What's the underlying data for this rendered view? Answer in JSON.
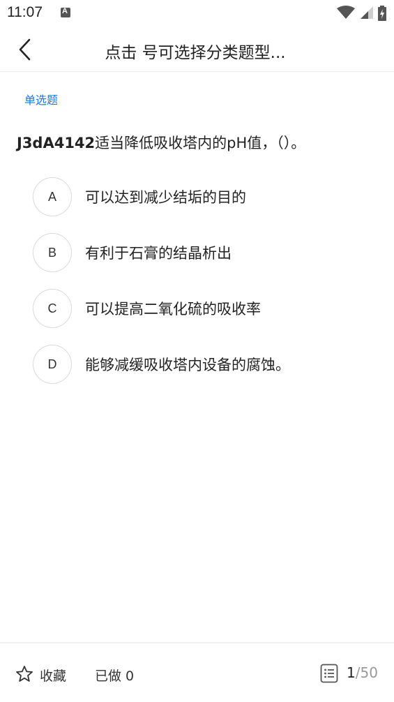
{
  "status_bar": {
    "time": "11:07",
    "icons": [
      "a-notification-icon",
      "wifi-icon",
      "cellular-signal-icon",
      "battery-icon"
    ]
  },
  "header": {
    "title": "点击 号可选择分类题型...",
    "back_icon": "chevron-left-icon"
  },
  "question": {
    "type": "单选题",
    "code": "J3dA4142",
    "text": "适当降低吸收塔内的pH值，（）。",
    "options": [
      {
        "letter": "A",
        "text": "可以达到减少结垢的目的"
      },
      {
        "letter": "B",
        "text": "有利于石膏的结晶析出"
      },
      {
        "letter": "C",
        "text": "可以提高二氧化硫的吸收率"
      },
      {
        "letter": "D",
        "text": "能够减缓吸收塔内设备的腐蚀。"
      }
    ]
  },
  "footer": {
    "favorite_label": "收藏",
    "done_label": "已做 0",
    "current": "1",
    "separator": "/",
    "total": "50"
  },
  "colors": {
    "accent": "#1a7bd8",
    "text": "#222222",
    "muted": "#999999",
    "border": "#d9d9d9"
  }
}
